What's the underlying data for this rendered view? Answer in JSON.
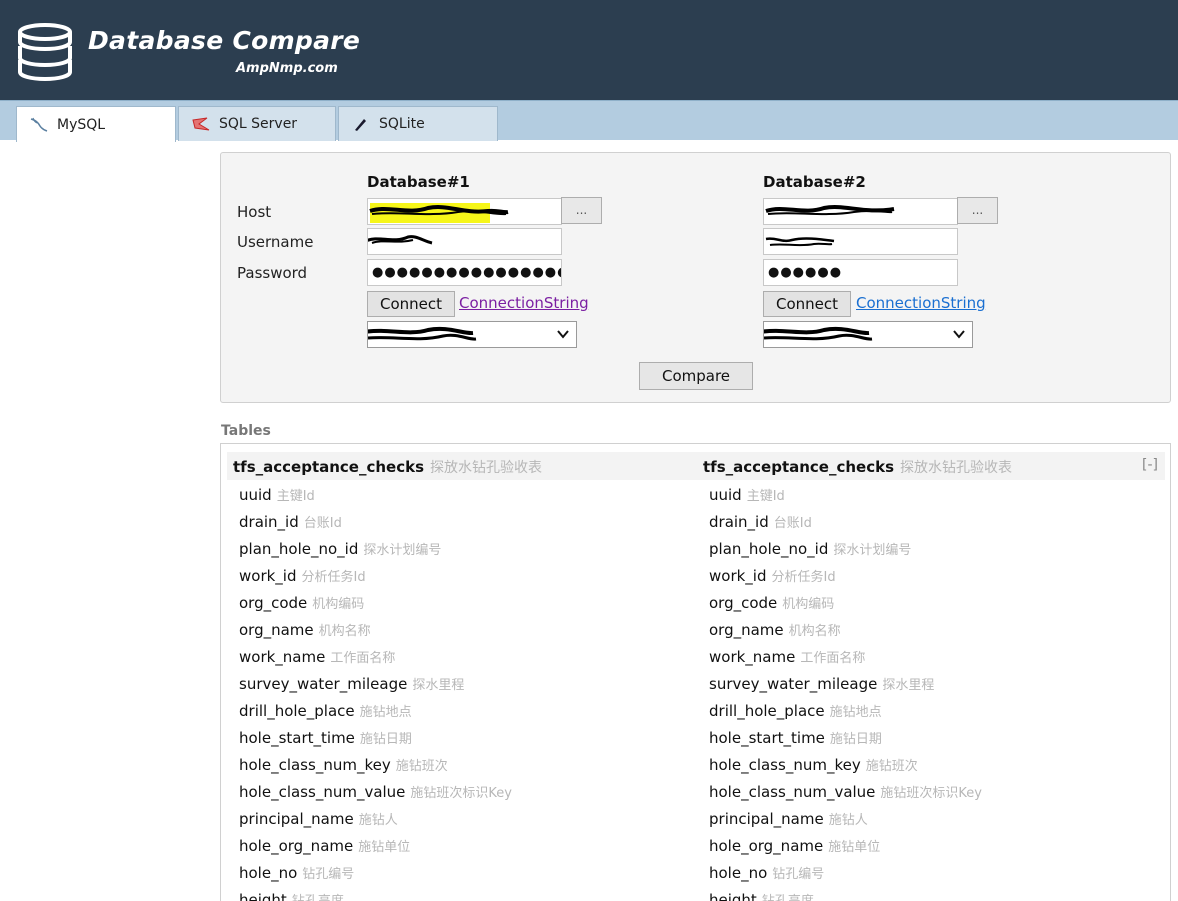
{
  "header": {
    "title": "Database Compare",
    "subtitle": "AmpNmp.com"
  },
  "tabs": [
    {
      "label": "MySQL",
      "icon": "mysql-dolphin-icon",
      "active": true
    },
    {
      "label": "SQL Server",
      "icon": "sql-server-icon",
      "active": false
    },
    {
      "label": "SQLite",
      "icon": "sqlite-feather-icon",
      "active": false
    }
  ],
  "labels": {
    "host": "Host",
    "username": "Username",
    "password": "Password"
  },
  "db1": {
    "heading": "Database#1",
    "password_masked": "●●●●●●●●●●●●●●●●",
    "browse_label": "...",
    "connect_label": "Connect",
    "link_label": "ConnectionString"
  },
  "db2": {
    "heading": "Database#2",
    "password_masked": "●●●●●●",
    "browse_label": "...",
    "connect_label": "Connect",
    "link_label": "ConnectionString"
  },
  "compare_label": "Compare",
  "tables_section": {
    "label": "Tables",
    "collapse_label": "[-]",
    "left": {
      "name": "tfs_acceptance_checks",
      "comment": "探放水钻孔验收表"
    },
    "right": {
      "name": "tfs_acceptance_checks",
      "comment": "探放水钻孔验收表"
    },
    "columns": [
      {
        "name": "uuid",
        "comment": "主键Id"
      },
      {
        "name": "drain_id",
        "comment": "台账Id"
      },
      {
        "name": "plan_hole_no_id",
        "comment": "探水计划编号"
      },
      {
        "name": "work_id",
        "comment": "分析任务Id"
      },
      {
        "name": "org_code",
        "comment": "机构编码"
      },
      {
        "name": "org_name",
        "comment": "机构名称"
      },
      {
        "name": "work_name",
        "comment": "工作面名称"
      },
      {
        "name": "survey_water_mileage",
        "comment": "探水里程"
      },
      {
        "name": "drill_hole_place",
        "comment": "施钻地点"
      },
      {
        "name": "hole_start_time",
        "comment": "施钻日期"
      },
      {
        "name": "hole_class_num_key",
        "comment": "施钻班次"
      },
      {
        "name": "hole_class_num_value",
        "comment": "施钻班次标识Key"
      },
      {
        "name": "principal_name",
        "comment": "施钻人"
      },
      {
        "name": "hole_org_name",
        "comment": "施钻单位"
      },
      {
        "name": "hole_no",
        "comment": "钻孔编号"
      },
      {
        "name": "height",
        "comment": "钻孔高度"
      }
    ]
  },
  "colors": {
    "header_bg": "#2c3e50",
    "tab_bar_bg": "#b3cce0",
    "link_visited": "#7b1fa2",
    "link": "#1a6fd1",
    "highlight": "#f5f500"
  }
}
